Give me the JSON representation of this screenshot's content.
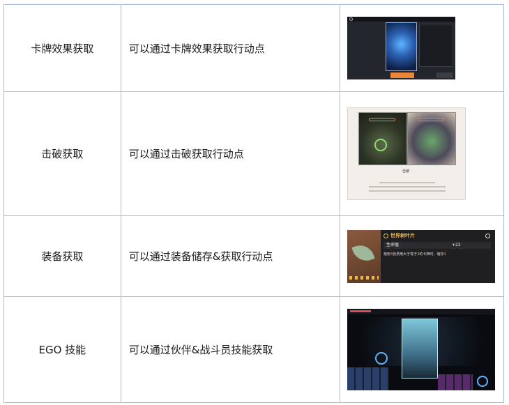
{
  "rows": [
    {
      "name": "卡牌效果获取",
      "desc": "可以通过卡牌效果获取行动点"
    },
    {
      "name": "击破获取",
      "desc": "可以通过击破获取行动点"
    },
    {
      "name": "装备获取",
      "desc": "可以通过装备储存&获取行动点"
    },
    {
      "name": "EGO 技能",
      "desc": "可以通过伙伴&战斗员技能获取"
    }
  ],
  "shot2": {
    "caption": "击破"
  },
  "shot3": {
    "title": "世界树叶片",
    "stat_label": "生命值",
    "stat_value": "+22",
    "desc_a": "使用",
    "num_a": "3",
    "desc_b": "张费用大于等于",
    "num_b": "2",
    "desc_c": "的卡牌时，储存",
    "num_c": "1"
  },
  "colors": {
    "accent": "#e8863a",
    "border": "#a9bfe0",
    "highlight": "#f0b84a"
  }
}
